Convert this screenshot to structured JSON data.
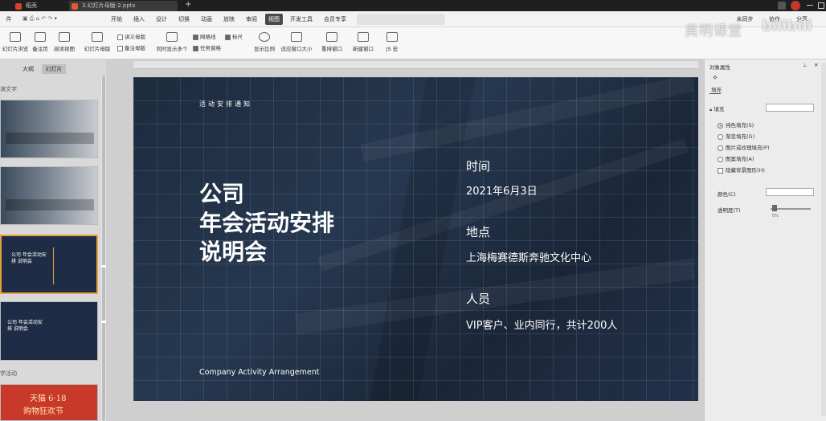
{
  "titlebar": {
    "tabs": [
      {
        "label": "稻壳",
        "color": "#d9412f"
      },
      {
        "label": "3.幻灯片母版-2.pptx",
        "color": "#e05a2b"
      }
    ],
    "new_tab": "+"
  },
  "menubar": {
    "file": "件",
    "items": [
      "开始",
      "插入",
      "设计",
      "切换",
      "动画",
      "放映",
      "审阅",
      "视图",
      "开发工具",
      "会员专享"
    ],
    "active": "视图",
    "right_items": [
      "未同步",
      "协作",
      "分享"
    ]
  },
  "ribbon": {
    "buttons": [
      "幻灯片浏览",
      "备注页",
      "阅读视图",
      "幻灯片母版",
      "同时显示多个",
      "显示比例",
      "适应窗口大小",
      "重排窗口",
      "新建窗口",
      "JS 宏"
    ],
    "checks": [
      {
        "label": "讲义母版",
        "checked": false
      },
      {
        "label": "备注母版",
        "checked": false
      },
      {
        "label": "网格线",
        "checked": true
      },
      {
        "label": "标尺",
        "checked": true
      },
      {
        "label": "任务窗格",
        "checked": true
      }
    ]
  },
  "left_panel": {
    "tabs": [
      "大纲",
      "幻灯片"
    ],
    "active_tab": "幻灯片",
    "section_label": "演文字",
    "section_label_2": "学活动",
    "thumb_texts": {
      "t3_title": "公司 年会活动安排 说明会",
      "t4_title": "公司 年会活动安排 说明会",
      "ad_line1": "天猫 6·18",
      "ad_line2": "购物狂欢节"
    }
  },
  "slide": {
    "header": "活动安排通知",
    "title_line1": "公司",
    "title_line2": "年会活动安排",
    "title_line3": "说明会",
    "subtitle": "Company Activity Arrangement",
    "items": [
      {
        "label": "时间",
        "value": "2021年6月3日"
      },
      {
        "label": "地点",
        "value": "上海梅赛德斯奔驰文化中心"
      },
      {
        "label": "人员",
        "value": "VIP客户、业内同行，共计200人"
      }
    ]
  },
  "right_panel": {
    "title": "对象属性",
    "tab": "填充",
    "section": "填充",
    "options": [
      {
        "label": "纯色填充(S)",
        "selected": true
      },
      {
        "label": "渐变填充(G)",
        "selected": false
      },
      {
        "label": "图片或纹理填充(P)",
        "selected": false
      },
      {
        "label": "图案填充(A)",
        "selected": false
      }
    ],
    "hide_bg": "隐藏背景图形(H)",
    "color_label": "颜色(C)",
    "transparency_label": "透明度(T)",
    "transparency_value": "0%"
  },
  "watermark": {
    "text": "吴明课堂",
    "logo": "bilibili"
  }
}
